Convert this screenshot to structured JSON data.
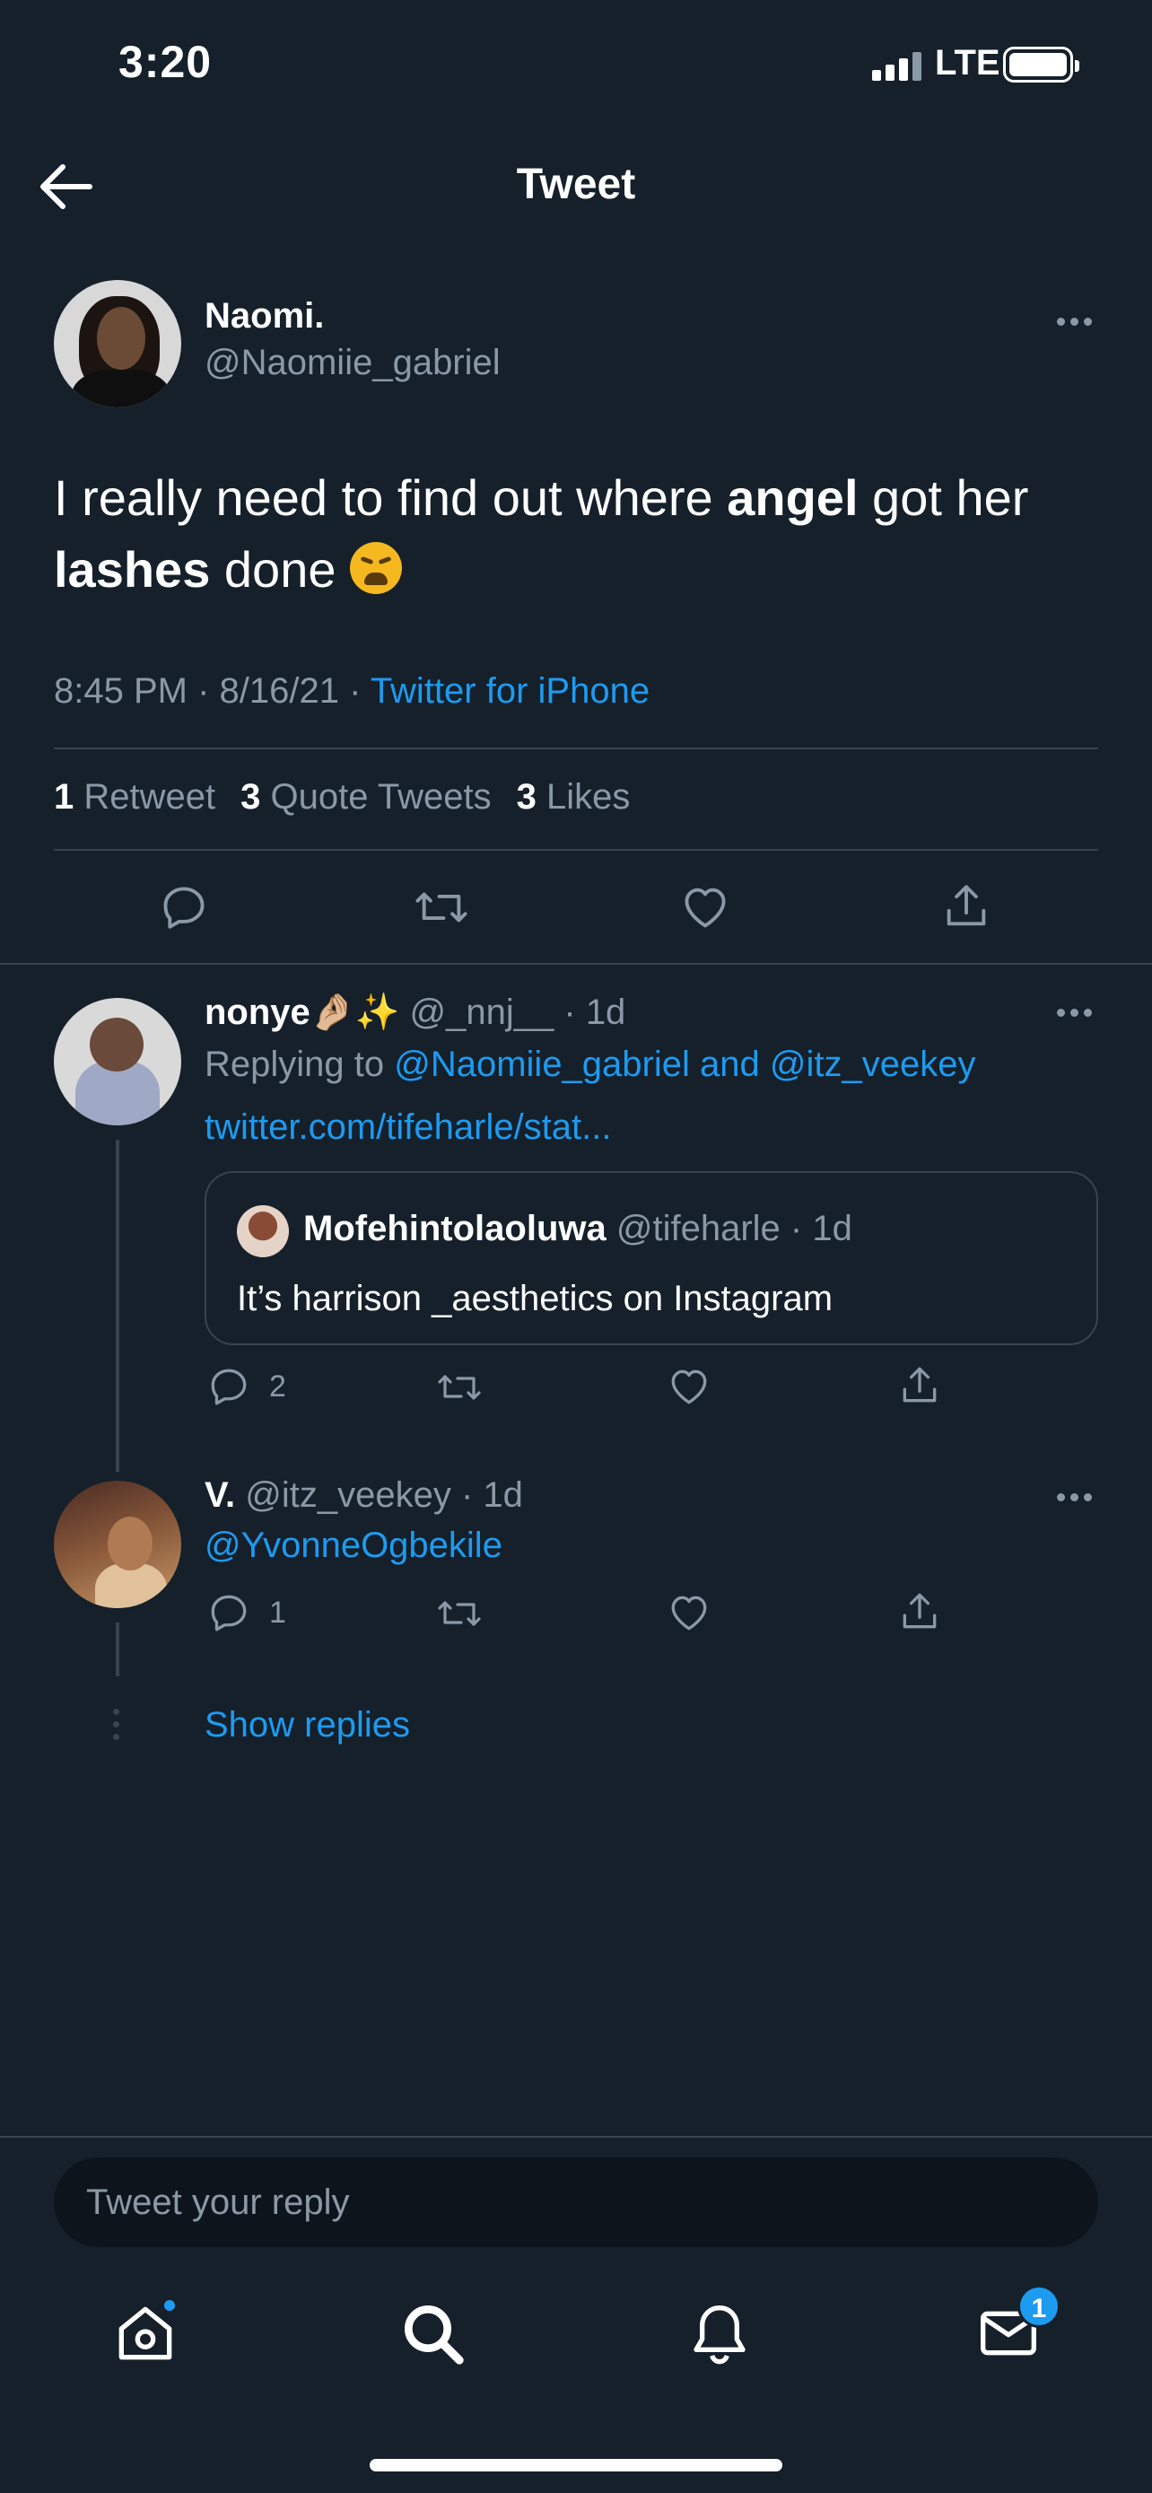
{
  "status_bar": {
    "time": "3:20",
    "network": "LTE"
  },
  "header": {
    "title": "Tweet"
  },
  "tweet": {
    "author_name": "Naomi.",
    "author_handle": "@Naomiie_gabriel",
    "text_parts": [
      "I really need to find out where ",
      "angel",
      " got her ",
      "lashes",
      " done"
    ],
    "emoji": "weary-face",
    "time": "8:45 PM",
    "date": "8/16/21",
    "source": "Twitter for iPhone",
    "stats": {
      "retweets_count": "1",
      "retweets_label": "Retweet",
      "quotes_count": "3",
      "quotes_label": "Quote Tweets",
      "likes_count": "3",
      "likes_label": "Likes"
    }
  },
  "replies": [
    {
      "name": "nonye🤌🏼✨",
      "handle": "@_nnj__",
      "age": "1d",
      "replying_prefix": "Replying to ",
      "replying_to": "@Naomiie_gabriel and @itz_veekey",
      "link": "twitter.com/tifeharle/stat...",
      "quote": {
        "name": "Mofehintolaoluwa",
        "handle": "@tifeharle",
        "age": "1d",
        "text": "It’s harrison _aesthetics on Instagram"
      },
      "reply_count": "2"
    },
    {
      "name": "V.",
      "handle": "@itz_veekey",
      "age": "1d",
      "mention": "@YvonneOgbekile",
      "reply_count": "1"
    }
  ],
  "show_replies": "Show replies",
  "compose": {
    "placeholder": "Tweet your reply"
  },
  "tabbar": {
    "items": [
      "home-icon",
      "search-icon",
      "bell-icon",
      "mail-icon"
    ],
    "messages_badge": "1"
  },
  "colors": {
    "background": "#15202b",
    "accent": "#1d9bf0",
    "muted": "#8b98a5",
    "divider": "#38444d"
  }
}
